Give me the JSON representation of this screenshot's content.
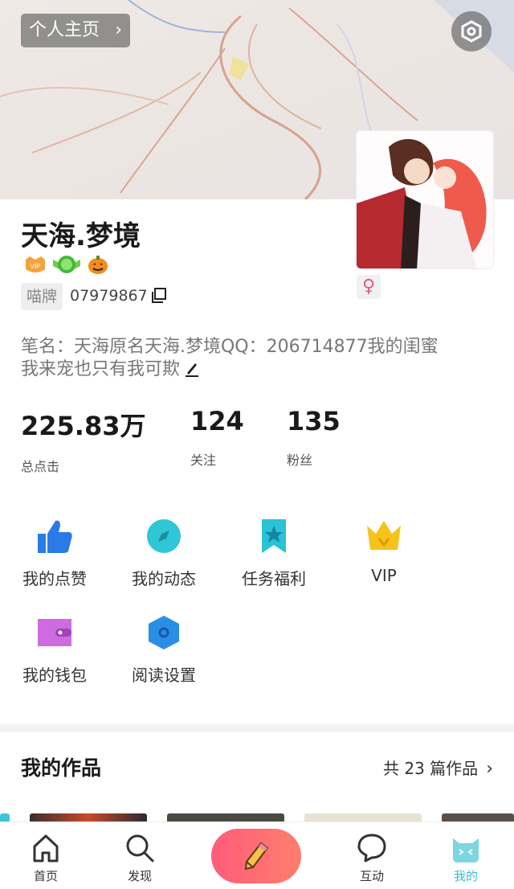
{
  "header": {
    "home_label": "个人主页",
    "home_chevron": "›",
    "settings_icon": "settings-hex-icon"
  },
  "profile": {
    "name": "天海.梦境",
    "badges": [
      "vip-badge-icon",
      "green-level-badge-icon",
      "pumpkin-badge-icon"
    ],
    "miaopai_label": "喵牌",
    "uid": "07979867",
    "gender_symbol": "♀",
    "bio_line1": "笔名：天海原名天海.梦境QQ：206714877我的闺蜜",
    "bio_line2": "我来宠也只有我可欺"
  },
  "stats": [
    {
      "value": "225.83万",
      "label": "总点击"
    },
    {
      "value": "124",
      "label": "关注"
    },
    {
      "value": "135",
      "label": "粉丝"
    }
  ],
  "menu": [
    {
      "label": "我的点赞",
      "icon": "thumbs-up-icon",
      "color": "#2b7be6"
    },
    {
      "label": "我的动态",
      "icon": "compass-icon",
      "color": "#2fc6d8"
    },
    {
      "label": "任务福利",
      "icon": "bookmark-star-icon",
      "color": "#29c2d6"
    },
    {
      "label": "VIP",
      "icon": "crown-icon",
      "color": "#f7c21b"
    },
    {
      "label": "我的钱包",
      "icon": "wallet-icon",
      "color": "#cf6be0"
    },
    {
      "label": "阅读设置",
      "icon": "hexagon-settings-icon",
      "color": "#2b8ee6"
    }
  ],
  "works": {
    "title": "我的作品",
    "count_text": "共 23 篇作品",
    "chevron": "›"
  },
  "tabbar": [
    {
      "label": "首页",
      "icon": "home-icon"
    },
    {
      "label": "发现",
      "icon": "search-icon"
    },
    {
      "label": "",
      "icon": "pencil-icon"
    },
    {
      "label": "互动",
      "icon": "chat-bubble-icon"
    },
    {
      "label": "我的",
      "icon": "cat-face-icon",
      "active": true
    }
  ],
  "colors": {
    "accent": "#36c2d3",
    "write_button": "#ff6b76"
  }
}
